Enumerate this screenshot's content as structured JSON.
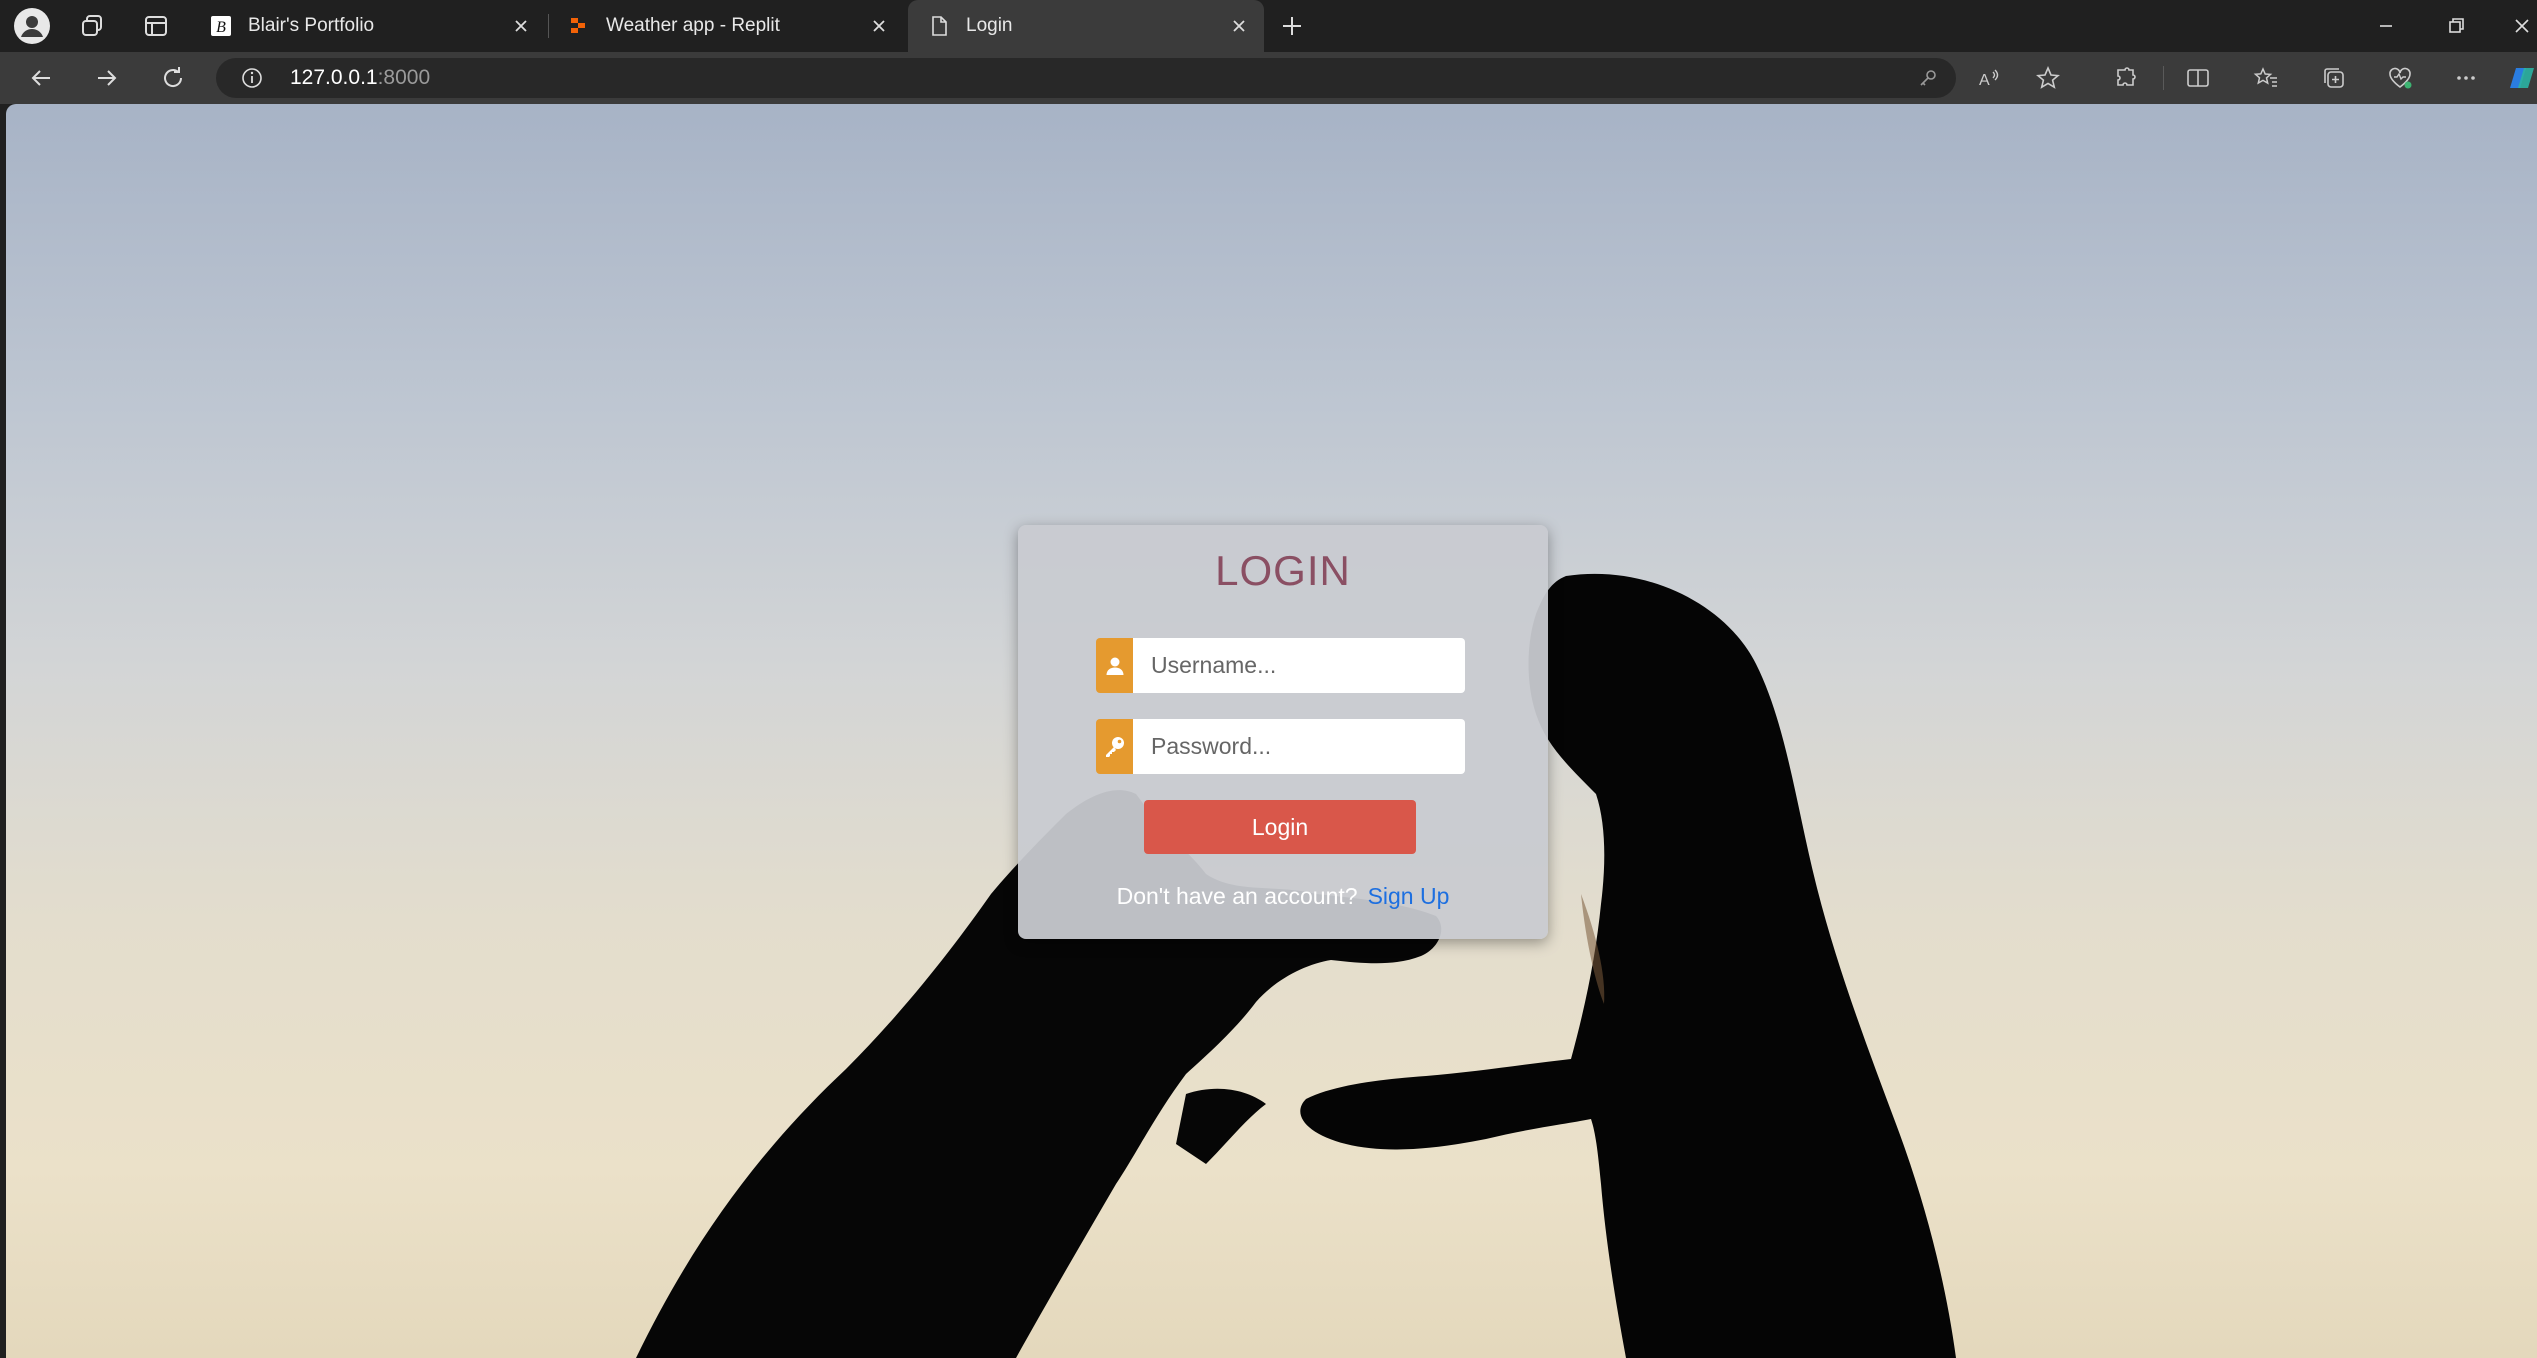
{
  "browser": {
    "tabs": [
      {
        "title": "Blair's Portfolio",
        "active": false
      },
      {
        "title": "Weather app - Replit",
        "active": false
      },
      {
        "title": "Login",
        "active": true
      }
    ],
    "address": {
      "host": "127.0.0.1",
      "port": ":8000"
    }
  },
  "login": {
    "title": "LOGIN",
    "username_placeholder": "Username...",
    "password_placeholder": "Password...",
    "button_label": "Login",
    "signup_prompt": "Don't have an account?",
    "signup_link": "Sign Up"
  },
  "colors": {
    "title": "#8a4f63",
    "input_prefix": "#e59a2f",
    "button": "#d9574a",
    "link": "#1d6fe0"
  },
  "icons": [
    "user-icon",
    "key-icon"
  ]
}
